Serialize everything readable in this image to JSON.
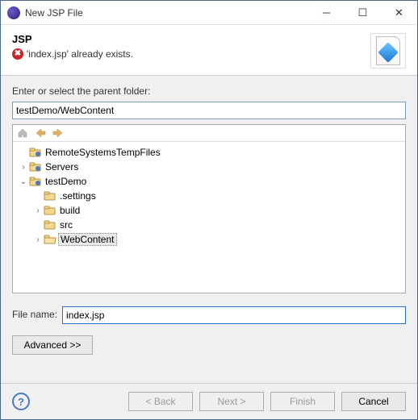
{
  "window": {
    "title": "New JSP File"
  },
  "banner": {
    "title": "JSP",
    "error": "'index.jsp' already exists."
  },
  "labels": {
    "parent_folder": "Enter or select the parent folder:",
    "file_name": "File name:"
  },
  "fields": {
    "parent_folder_value": "testDemo/WebContent",
    "file_name_value": "index.jsp"
  },
  "tree": {
    "items": [
      {
        "label": "RemoteSystemsTempFiles",
        "depth": 0,
        "twisty": "",
        "icon": "project",
        "selected": false
      },
      {
        "label": "Servers",
        "depth": 0,
        "twisty": ">",
        "icon": "project",
        "selected": false
      },
      {
        "label": "testDemo",
        "depth": 0,
        "twisty": "v",
        "icon": "project",
        "selected": false
      },
      {
        "label": ".settings",
        "depth": 1,
        "twisty": "",
        "icon": "folder",
        "selected": false
      },
      {
        "label": "build",
        "depth": 1,
        "twisty": ">",
        "icon": "folder",
        "selected": false
      },
      {
        "label": "src",
        "depth": 1,
        "twisty": "",
        "icon": "folder",
        "selected": false
      },
      {
        "label": "WebContent",
        "depth": 1,
        "twisty": ">",
        "icon": "folder-open",
        "selected": true
      }
    ]
  },
  "buttons": {
    "advanced": "Advanced >>",
    "back": "< Back",
    "next": "Next >",
    "finish": "Finish",
    "cancel": "Cancel"
  }
}
